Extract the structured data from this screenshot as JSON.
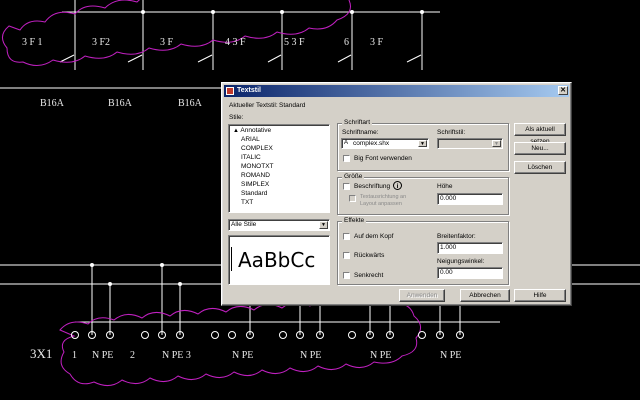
{
  "cad": {
    "top_labels": [
      "3 F 1",
      "3 F2",
      "3 F",
      "4 3 F",
      "5 3 F",
      "6",
      "3 F"
    ],
    "mid_labels": [
      "B16A",
      "B16A",
      "B16A"
    ],
    "terminal_block": "3X1",
    "bottom_labels": [
      "1",
      "N PE",
      "2",
      "N PE 3",
      "N PE",
      "N PE",
      "N PE",
      "N PE"
    ],
    "colors": {
      "cloud": "#c020c0",
      "lines": "#ffffff"
    }
  },
  "dialog": {
    "title": "Textstil",
    "close": "✕",
    "current_style_label": "Aktueller Textstil:",
    "current_style_value": "Standard",
    "styles_label": "Stile:",
    "styles": [
      "Annotative",
      "ARIAL",
      "COMPLEX",
      "ITALIC",
      "MONOTXT",
      "ROMAND",
      "SIMPLEX",
      "Standard",
      "TXT"
    ],
    "styles_filter": "Alle Stile",
    "preview_text": "AaBbCc",
    "font_group": {
      "caption": "Schriftart",
      "font_name_label": "Schriftname:",
      "font_name_value": "complex.shx",
      "font_style_label": "Schriftstil:",
      "font_style_value": "",
      "big_font_label": "Big Font verwenden"
    },
    "size_group": {
      "caption": "Größe",
      "annotative_label": "Beschriftung",
      "info_icon": "i",
      "match_layout_label": "Textausrichtung an Layout anpassen",
      "height_label": "Höhe",
      "height_value": "0.000"
    },
    "effects_group": {
      "caption": "Effekte",
      "upside_down_label": "Auf dem Kopf",
      "backwards_label": "Rückwärts",
      "vertical_label": "Senkrecht",
      "width_factor_label": "Breitenfaktor:",
      "width_factor_value": "1.000",
      "oblique_label": "Neigungswinkel:",
      "oblique_value": "0.00"
    },
    "buttons": {
      "set_current": "Als aktuell setzen",
      "new": "Neu...",
      "delete": "Löschen",
      "apply": "Anwenden",
      "cancel": "Abbrechen",
      "help": "Hilfe"
    }
  }
}
